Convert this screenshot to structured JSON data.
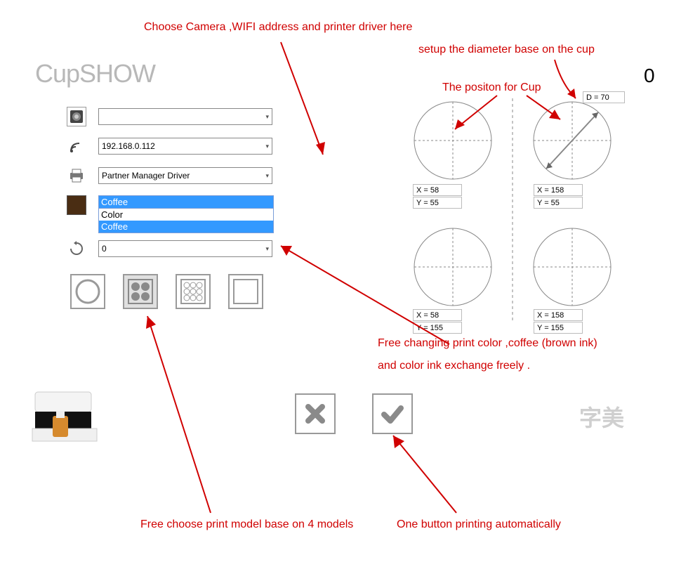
{
  "annotations": {
    "camera_wifi": "Choose Camera ,WIFI address and printer driver here",
    "diameter": "setup the diameter base on the cup",
    "position": "The positon for  Cup",
    "color_change_l1": "Free changing print color ,coffee (brown ink)",
    "color_change_l2": "and color ink exchange freely .",
    "models": "Free choose print model base on 4 models",
    "one_button": "One button printing automatically"
  },
  "app": {
    "title": "CupSHOW",
    "zero": "0",
    "watermark": "字美"
  },
  "fields": {
    "camera": "",
    "wifi": "192.168.0.112",
    "printer": "Partner Manager Driver",
    "rotation": "0"
  },
  "dropdown": {
    "selected": "Coffee",
    "options": [
      "Color",
      "Coffee"
    ]
  },
  "cups": {
    "diameter_label": "D = 70",
    "grid": [
      {
        "x": "X = 58",
        "y": "Y = 55"
      },
      {
        "x": "X = 158",
        "y": "Y = 55"
      },
      {
        "x": "X = 58",
        "y": "Y = 155"
      },
      {
        "x": "X = 158",
        "y": "Y = 155"
      }
    ]
  }
}
